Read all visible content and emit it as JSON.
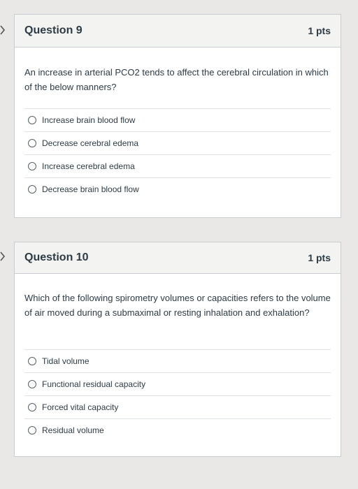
{
  "questions": [
    {
      "title": "Question 9",
      "points": "1 pts",
      "text": "An increase in arterial PCO2 tends to affect the cerebral circulation in which of the below manners?",
      "answers": [
        "Increase brain blood flow",
        "Decrease cerebral edema",
        "Increase cerebral edema",
        "Decrease brain blood flow"
      ]
    },
    {
      "title": "Question 10",
      "points": "1 pts",
      "text": "Which of the following spirometry volumes or capacities refers to the volume of air moved during a submaximal or resting inhalation and exhalation?",
      "answers": [
        "Tidal volume",
        "Functional residual capacity",
        "Forced vital capacity",
        "Residual volume"
      ]
    }
  ]
}
